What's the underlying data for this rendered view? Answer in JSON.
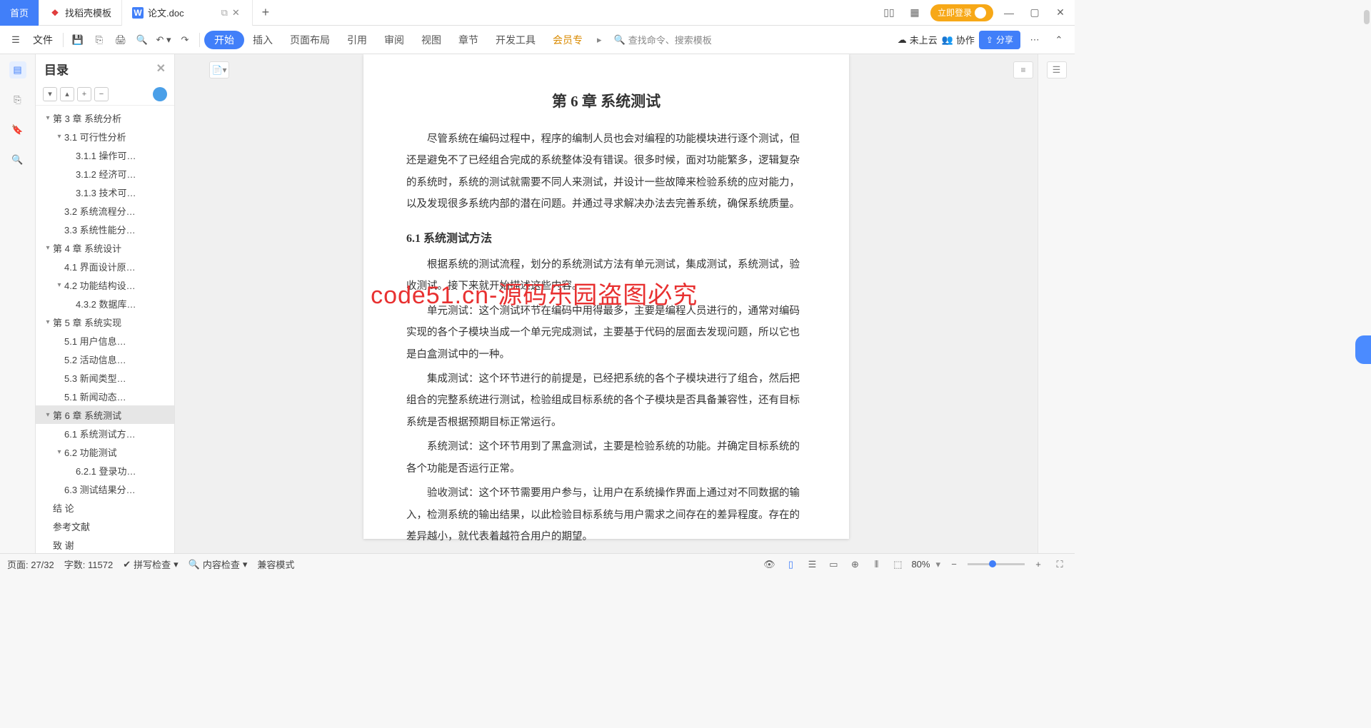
{
  "titlebar": {
    "home_label": "首页",
    "tab_template": "找稻壳模板",
    "tab_doc": "论文.doc",
    "login_label": "立即登录"
  },
  "ribbon": {
    "menu": "文件",
    "tabs": [
      "开始",
      "插入",
      "页面布局",
      "引用",
      "审阅",
      "视图",
      "章节",
      "开发工具",
      "会员专"
    ],
    "search_placeholder": "查找命令、搜索模板",
    "cloud": "未上云",
    "coop": "协作",
    "share": "分享"
  },
  "outline": {
    "title": "目录",
    "items": [
      {
        "level": 1,
        "label": "第 3 章  系统分析",
        "chev": "▾"
      },
      {
        "level": 2,
        "label": "3.1 可行性分析",
        "chev": "▾"
      },
      {
        "level": 3,
        "label": "3.1.1 操作可…"
      },
      {
        "level": 3,
        "label": "3.1.2 经济可…"
      },
      {
        "level": 3,
        "label": "3.1.3 技术可…"
      },
      {
        "level": 2,
        "label": "3.2 系统流程分…"
      },
      {
        "level": 2,
        "label": "3.3 系统性能分…"
      },
      {
        "level": 1,
        "label": "第 4 章  系统设计",
        "chev": "▾"
      },
      {
        "level": 2,
        "label": "4.1 界面设计原…"
      },
      {
        "level": 2,
        "label": "4.2 功能结构设…",
        "chev": "▾"
      },
      {
        "level": 3,
        "label": "4.3.2 数据库…"
      },
      {
        "level": 1,
        "label": "第 5 章  系统实现",
        "chev": "▾"
      },
      {
        "level": 2,
        "label": "5.1 用户信息…"
      },
      {
        "level": 2,
        "label": "5.2 活动信息…"
      },
      {
        "level": 2,
        "label": "5.3 新闻类型…"
      },
      {
        "level": 2,
        "label": "5.1 新闻动态…"
      },
      {
        "level": 1,
        "label": "第 6 章  系统测试",
        "chev": "▾",
        "selected": true
      },
      {
        "level": 2,
        "label": "6.1 系统测试方…"
      },
      {
        "level": 2,
        "label": "6.2 功能测试",
        "chev": "▾"
      },
      {
        "level": 3,
        "label": "6.2.1 登录功…"
      },
      {
        "level": 2,
        "label": "6.3 测试结果分…"
      },
      {
        "level": 1,
        "label": "结  论"
      },
      {
        "level": 1,
        "label": "参考文献"
      },
      {
        "level": 1,
        "label": "致  谢"
      }
    ]
  },
  "document": {
    "chapter_title": "第 6 章  系统测试",
    "intro": "尽管系统在编码过程中，程序的编制人员也会对编程的功能模块进行逐个测试，但还是避免不了已经组合完成的系统整体没有错误。很多时候，面对功能繁多，逻辑复杂的系统时，系统的测试就需要不同人来测试，并设计一些故障来检验系统的应对能力，以及发现很多系统内部的潜在问题。并通过寻求解决办法去完善系统，确保系统质量。",
    "sec61_title": "6.1  系统测试方法",
    "p1": "根据系统的测试流程，划分的系统测试方法有单元测试，集成测试，系统测试，验收测试。接下来就开始描述这些内容。",
    "p2": "单元测试：这个测试环节在编码中用得最多，主要是编程人员进行的，通常对编码实现的各个子模块当成一个单元完成测试，主要基于代码的层面去发现问题，所以它也是白盒测试中的一种。",
    "p3": "集成测试：这个环节进行的前提是，已经把系统的各个子模块进行了组合，然后把组合的完整系统进行测试，检验组成目标系统的各个子模块是否具备兼容性，还有目标系统是否根据预期目标正常运行。",
    "p4": "系统测试：这个环节用到了黑盒测试，主要是检验系统的功能。并确定目标系统的各个功能是否运行正常。",
    "p5": "验收测试：这个环节需要用户参与，让用户在系统操作界面上通过对不同数据的输入，检测系统的输出结果，以此检验目标系统与用户需求之间存在的差异程度。存在的差异越小，就代表着越符合用户的期望。",
    "watermark": "code51.cn-源码乐园盗图必究"
  },
  "statusbar": {
    "page": "页面: 27/32",
    "wordcount": "字数: 11572",
    "spell": "拼写检查",
    "content": "内容检查",
    "compat": "兼容模式",
    "zoom": "80%"
  }
}
